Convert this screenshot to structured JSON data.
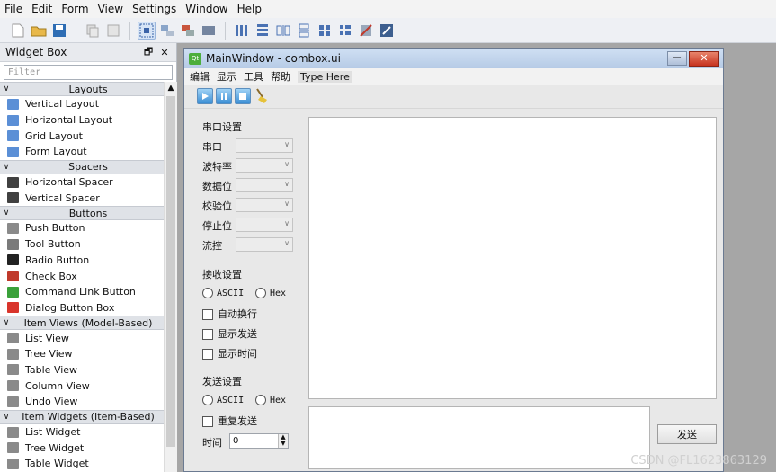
{
  "menubar": [
    "File",
    "Edit",
    "Form",
    "View",
    "Settings",
    "Window",
    "Help"
  ],
  "widget_box": {
    "title": "Widget Box",
    "float_btn": "🗗",
    "close_btn": "✕",
    "filter_placeholder": "Filter",
    "categories": [
      {
        "name": "Layouts",
        "items": [
          {
            "label": "Vertical Layout",
            "icon": "vertical-layout-icon",
            "color": "#5b8fd6"
          },
          {
            "label": "Horizontal Layout",
            "icon": "horizontal-layout-icon",
            "color": "#5b8fd6"
          },
          {
            "label": "Grid Layout",
            "icon": "grid-layout-icon",
            "color": "#5b8fd6"
          },
          {
            "label": "Form Layout",
            "icon": "form-layout-icon",
            "color": "#5b8fd6"
          }
        ]
      },
      {
        "name": "Spacers",
        "items": [
          {
            "label": "Horizontal Spacer",
            "icon": "horizontal-spacer-icon",
            "color": "#404040"
          },
          {
            "label": "Vertical Spacer",
            "icon": "vertical-spacer-icon",
            "color": "#404040"
          }
        ]
      },
      {
        "name": "Buttons",
        "items": [
          {
            "label": "Push Button",
            "icon": "push-button-icon",
            "color": "#8a8a8a"
          },
          {
            "label": "Tool Button",
            "icon": "tool-button-icon",
            "color": "#7a7a7a"
          },
          {
            "label": "Radio Button",
            "icon": "radio-button-icon",
            "color": "#222222"
          },
          {
            "label": "Check Box",
            "icon": "check-box-icon",
            "color": "#c0392b"
          },
          {
            "label": "Command Link Button",
            "icon": "command-link-icon",
            "color": "#3aa13a"
          },
          {
            "label": "Dialog Button Box",
            "icon": "dialog-button-box-icon",
            "color": "#d9342b"
          }
        ]
      },
      {
        "name": "Item Views (Model-Based)",
        "items": [
          {
            "label": "List View",
            "icon": "list-view-icon",
            "color": "#8a8a8a"
          },
          {
            "label": "Tree View",
            "icon": "tree-view-icon",
            "color": "#8a8a8a"
          },
          {
            "label": "Table View",
            "icon": "table-view-icon",
            "color": "#8a8a8a"
          },
          {
            "label": "Column View",
            "icon": "column-view-icon",
            "color": "#8a8a8a"
          },
          {
            "label": "Undo View",
            "icon": "undo-view-icon",
            "color": "#8a8a8a"
          }
        ]
      },
      {
        "name": "Item Widgets (Item-Based)",
        "items": [
          {
            "label": "List Widget",
            "icon": "list-widget-icon",
            "color": "#8a8a8a"
          },
          {
            "label": "Tree Widget",
            "icon": "tree-widget-icon",
            "color": "#8a8a8a"
          },
          {
            "label": "Table Widget",
            "icon": "table-widget-icon",
            "color": "#8a8a8a"
          }
        ]
      }
    ]
  },
  "form_window": {
    "title": "MainWindow - combox.ui",
    "qt_badge": "Qt",
    "minimize": "—",
    "close": "✕",
    "menu": [
      "编辑",
      "显示",
      "工具",
      "帮助"
    ],
    "menu_type_here": "Type Here",
    "serial_group": "串口设置",
    "serial_fields": [
      "串口",
      "波特率",
      "数据位",
      "校验位",
      "停止位",
      "流控"
    ],
    "receive_group": "接收设置",
    "receive_ascii": "ASCII",
    "receive_hex": "Hex",
    "receive_checks": [
      "自动换行",
      "显示发送",
      "显示时间"
    ],
    "send_group": "发送设置",
    "send_ascii": "ASCII",
    "send_hex": "Hex",
    "send_repeat": "重复发送",
    "time_label": "时间",
    "time_value": "0",
    "send_button": "发送"
  },
  "watermark": "CSDN @FL1623863129"
}
